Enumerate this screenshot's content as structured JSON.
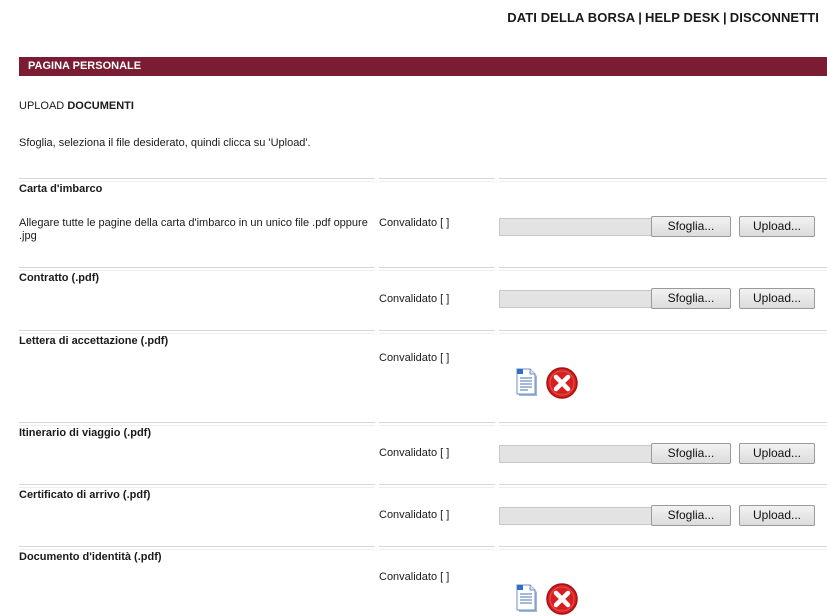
{
  "topnav": {
    "link1": "DATI DELLA BORSA",
    "link2": "HELP DESK",
    "link3": "DISCONNETTI",
    "separator": "|"
  },
  "banner": {
    "title": "PAGINA PERSONALE"
  },
  "section": {
    "prefix": "UPLOAD",
    "bold": "DOCUMENTI"
  },
  "instructions": "Sfoglia, seleziona il file desiderato, quindi clicca su 'Upload'.",
  "labels": {
    "status": "Convalidato [ ]",
    "browse": "Sfoglia...",
    "upload": "Upload..."
  },
  "documents": [
    {
      "title": "Carta d'imbarco",
      "description": "Allegare tutte le pagine della carta d'imbarco in un unico file .pdf oppure .jpg",
      "state": "empty"
    },
    {
      "title": "Contratto (.pdf)",
      "description": "",
      "state": "empty"
    },
    {
      "title": "Lettera di accettazione (.pdf)",
      "description": "",
      "state": "uploaded"
    },
    {
      "title": "Itinerario di viaggio (.pdf)",
      "description": "",
      "state": "empty"
    },
    {
      "title": "Certificato di arrivo (.pdf)",
      "description": "",
      "state": "empty"
    },
    {
      "title": "Documento d'identità (.pdf)",
      "description": "",
      "state": "uploaded"
    }
  ],
  "colors": {
    "banner": "#7a1d33",
    "delete_icon": "#d62020"
  },
  "icons": {
    "view": "document-icon",
    "delete": "delete-icon"
  }
}
